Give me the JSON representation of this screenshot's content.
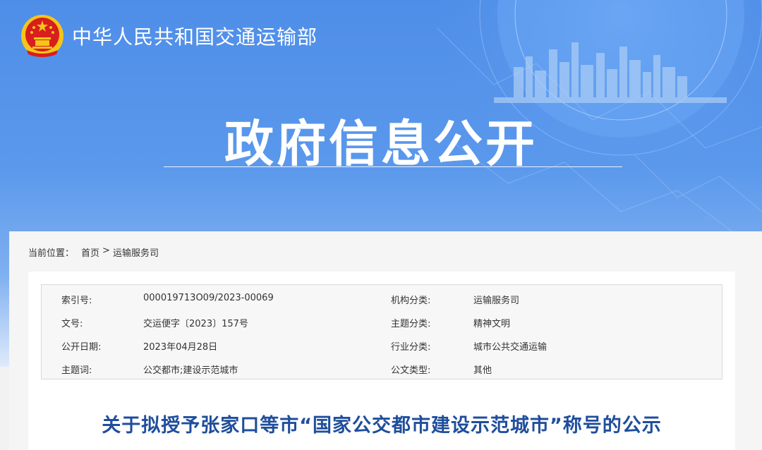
{
  "header": {
    "ministry_name": "中华人民共和国交通运输部",
    "section_title": "政府信息公开",
    "emblem_icon": "national-emblem-icon"
  },
  "breadcrumb": {
    "label": "当前位置：",
    "items": [
      "首页",
      "运输服务司"
    ],
    "separator": ">"
  },
  "metadata": {
    "rows": [
      {
        "k1": "索引号:",
        "v1": "000019713O09/2023-00069",
        "k2": "机构分类:",
        "v2": "运输服务司"
      },
      {
        "k1": "文号:",
        "v1": "交运便字〔2023〕157号",
        "k2": "主题分类:",
        "v2": "精神文明"
      },
      {
        "k1": "公开日期:",
        "v1": "2023年04月28日",
        "k2": "行业分类:",
        "v2": "城市公共交通运输"
      },
      {
        "k1": "主题词:",
        "v1": "公交都市;建设示范城市",
        "k2": "公文类型:",
        "v2": "其他"
      }
    ]
  },
  "document": {
    "title": "关于拟授予张家口等市“国家公交都市建设示范城市”称号的公示"
  },
  "colors": {
    "banner_blue": "#4f8ee8",
    "title_blue": "#1f4e9c",
    "emblem_red": "#d81e1e",
    "emblem_gold": "#f5c518"
  }
}
